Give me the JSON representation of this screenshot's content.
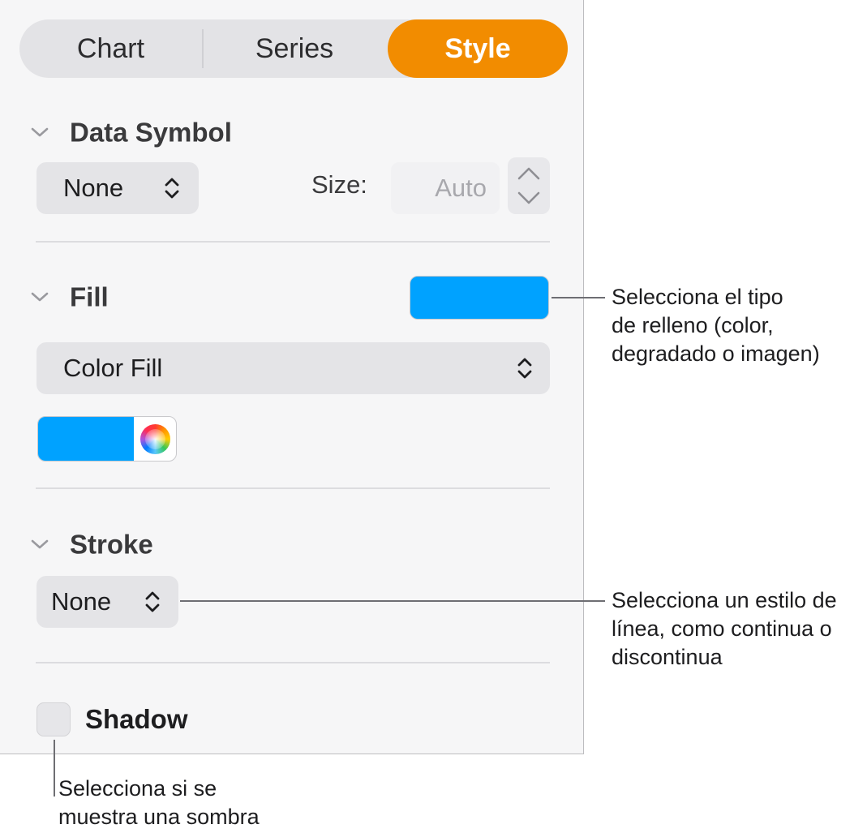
{
  "tabs": {
    "chart": "Chart",
    "series": "Series",
    "style": "Style"
  },
  "data_symbol": {
    "title": "Data Symbol",
    "popup_value": "None",
    "size_label": "Size:",
    "size_value": "Auto"
  },
  "fill": {
    "title": "Fill",
    "swatch_color": "#00a2ff",
    "type_value": "Color Fill",
    "well_color": "#00a2ff"
  },
  "stroke": {
    "title": "Stroke",
    "popup_value": "None"
  },
  "shadow": {
    "label": "Shadow",
    "checked": false
  },
  "callouts": {
    "fill_lines": [
      "Selecciona el tipo",
      "de relleno (color,",
      "degradado o imagen)"
    ],
    "stroke_lines": [
      "Selecciona un estilo de",
      "línea, como continua o",
      "discontinua"
    ],
    "shadow_lines": [
      "Selecciona si se",
      "muestra una sombra"
    ]
  },
  "icons": {
    "disclosure": "chevron-down-icon",
    "popup": "up-down-arrows-icon",
    "stepper": "stepper-arrows-icon",
    "color_wheel": "color-wheel-icon"
  },
  "colors": {
    "accent": "#f28c00",
    "fill": "#00a2ff"
  }
}
